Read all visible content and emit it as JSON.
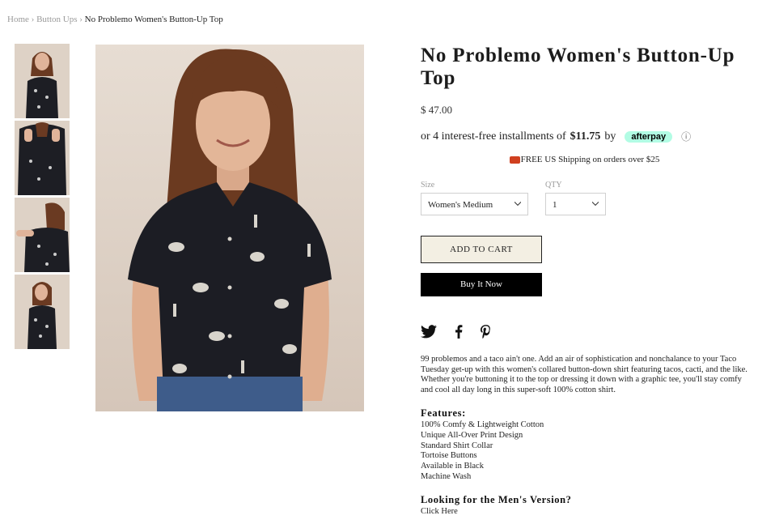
{
  "breadcrumb": {
    "home": "Home",
    "sep1": "›",
    "category": "Button Ups",
    "sep2": "›",
    "current": "No Problemo Women's Button-Up Top"
  },
  "product": {
    "title": "No Problemo Women's Button-Up Top",
    "price": "$ 47.00",
    "installments_prefix": "or 4 interest-free installments of",
    "installment_amount": "$11.75",
    "installments_by": "by",
    "afterpay_label": "afterpay",
    "info_icon": "ⓘ",
    "shipping": "FREE US Shipping on orders over $25"
  },
  "options": {
    "size_label": "Size",
    "size_value": "Women's Medium",
    "qty_label": "QTY",
    "qty_value": "1"
  },
  "buttons": {
    "add_to_cart": "ADD TO CART",
    "buy_now": "Buy It Now"
  },
  "social": [
    "twitter-icon",
    "facebook-icon",
    "pinterest-icon"
  ],
  "description": "99 problemos and a taco ain't one. Add an air of sophistication and nonchalance to your Taco Tuesday get-up with this women's collared button-down shirt featuring tacos, cacti, and the like. Whether you're buttoning it to the top or dressing it down with a graphic tee, you'll stay comfy and cool all day long in this super-soft 100% cotton shirt.",
  "features": {
    "heading": "Features:",
    "items": [
      "100% Comfy & Lightweight Cotton",
      "Unique All-Over Print Design",
      "Standard Shirt Collar",
      "Tortoise Buttons",
      "Available in Black",
      "Machine Wash"
    ]
  },
  "mens": {
    "heading": "Looking for the Men's Version?",
    "link": "Click Here"
  },
  "colors": {
    "afterpay": "#b2fce4",
    "cart_bg": "#f3efe3",
    "buy_bg": "#000000"
  }
}
